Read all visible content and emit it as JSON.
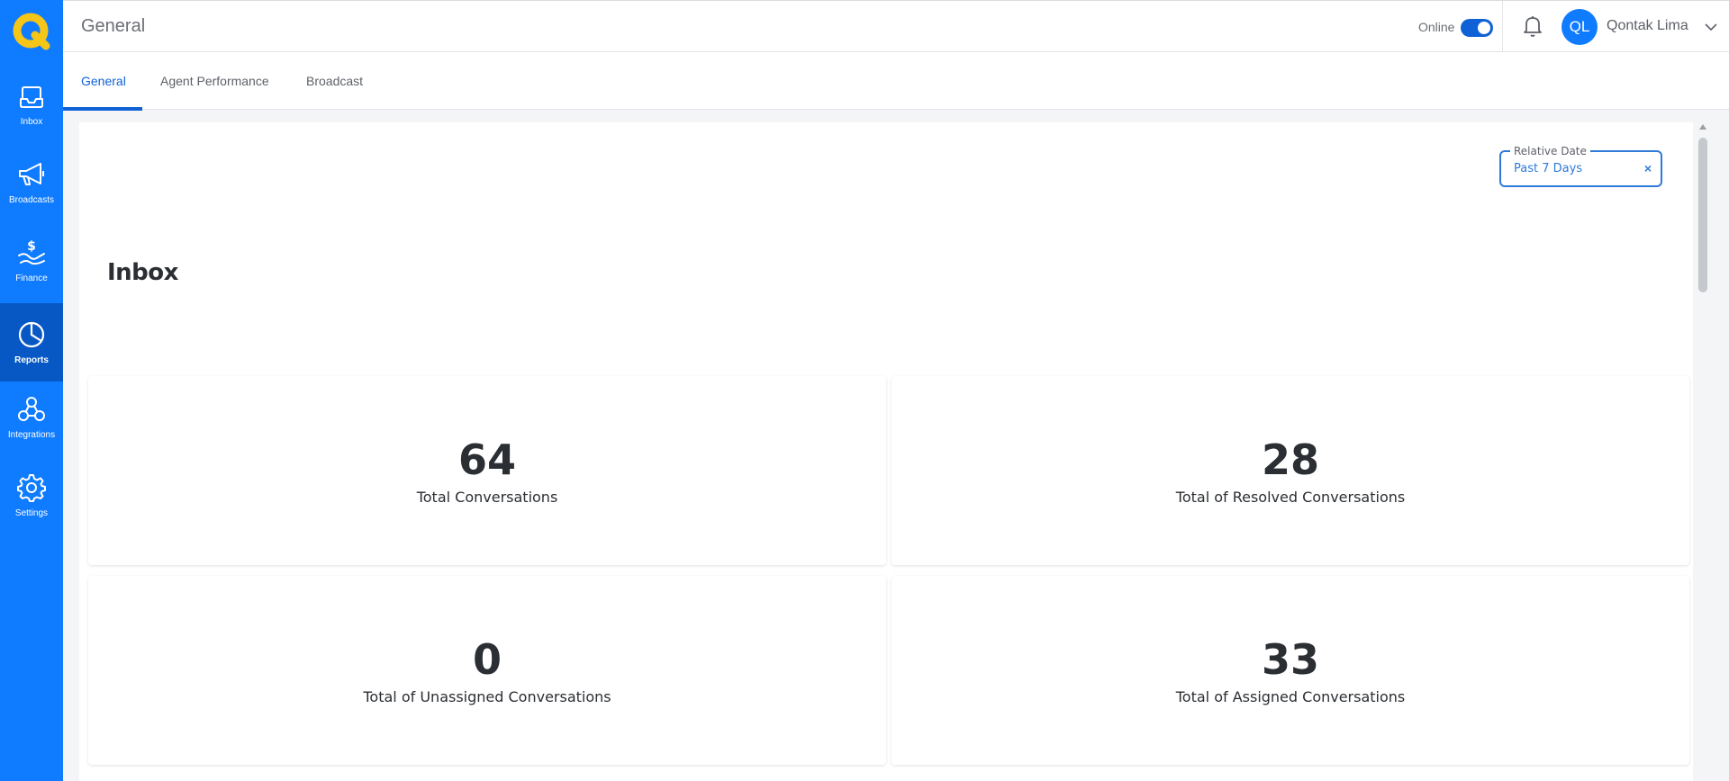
{
  "sidebar": {
    "items": [
      {
        "label": "Inbox",
        "icon": "inbox-icon"
      },
      {
        "label": "Broadcasts",
        "icon": "megaphone-icon"
      },
      {
        "label": "Finance",
        "icon": "finance-icon"
      },
      {
        "label": "Reports",
        "icon": "pie-chart-icon",
        "active": true
      },
      {
        "label": "Integrations",
        "icon": "integrations-icon"
      },
      {
        "label": "Settings",
        "icon": "gear-icon"
      }
    ]
  },
  "header": {
    "title": "General",
    "status_label": "Online",
    "user_initials": "QL",
    "user_name": "Qontak Lima"
  },
  "tabs": [
    {
      "label": "General",
      "active": true
    },
    {
      "label": "Agent Performance"
    },
    {
      "label": "Broadcast"
    }
  ],
  "filter": {
    "legend": "Relative Date",
    "value": "Past 7 Days",
    "clear": "×"
  },
  "section": {
    "title": "Inbox"
  },
  "stats": [
    {
      "value": "64",
      "label": "Total Conversations"
    },
    {
      "value": "28",
      "label": "Total of Resolved Conversations"
    },
    {
      "value": "0",
      "label": "Total of Unassigned Conversations"
    },
    {
      "value": "33",
      "label": "Total of Assigned Conversations"
    }
  ],
  "colors": {
    "brand": "#0f7bff",
    "sidebar_active": "#0758c4",
    "accent": "#0f62d6",
    "logo_yellow": "#f5c518"
  }
}
